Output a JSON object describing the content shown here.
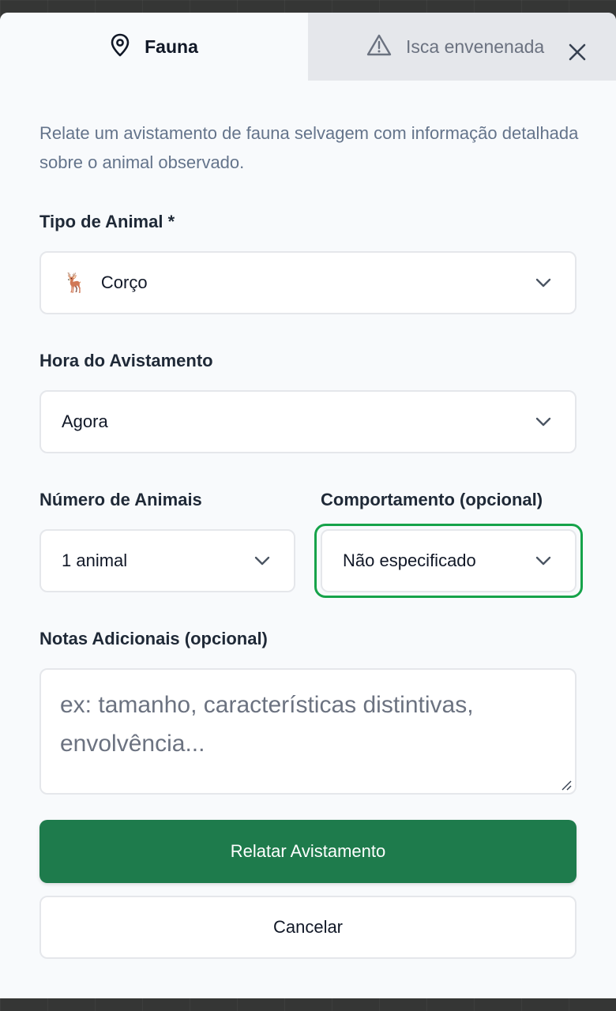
{
  "tabs": {
    "fauna": {
      "label": "Fauna",
      "icon": "map-pin-icon",
      "active": true
    },
    "bait": {
      "label": "Isca envenenada",
      "icon": "warning-triangle-icon",
      "active": false
    }
  },
  "close": {
    "icon": "close-icon"
  },
  "intro": "Relate um avistamento de fauna selvagem com informação detalhada sobre o animal observado.",
  "form": {
    "animal_type": {
      "label": "Tipo de Animal *",
      "value": "Corço",
      "emoji": "🦌"
    },
    "sighting_time": {
      "label": "Hora do Avistamento",
      "value": "Agora"
    },
    "animal_count": {
      "label": "Número de Animais",
      "value": "1 animal"
    },
    "behavior": {
      "label": "Comportamento (opcional)",
      "value": "Não especificado",
      "focused": true
    },
    "notes": {
      "label": "Notas Adicionais (opcional)",
      "placeholder": "ex: tamanho, características distintivas, envolvência...",
      "value": ""
    }
  },
  "actions": {
    "submit_label": "Relatar Avistamento",
    "cancel_label": "Cancelar"
  },
  "colors": {
    "primary": "#1e7b4c",
    "focus": "#16a34a",
    "muted_text": "#64748b"
  }
}
